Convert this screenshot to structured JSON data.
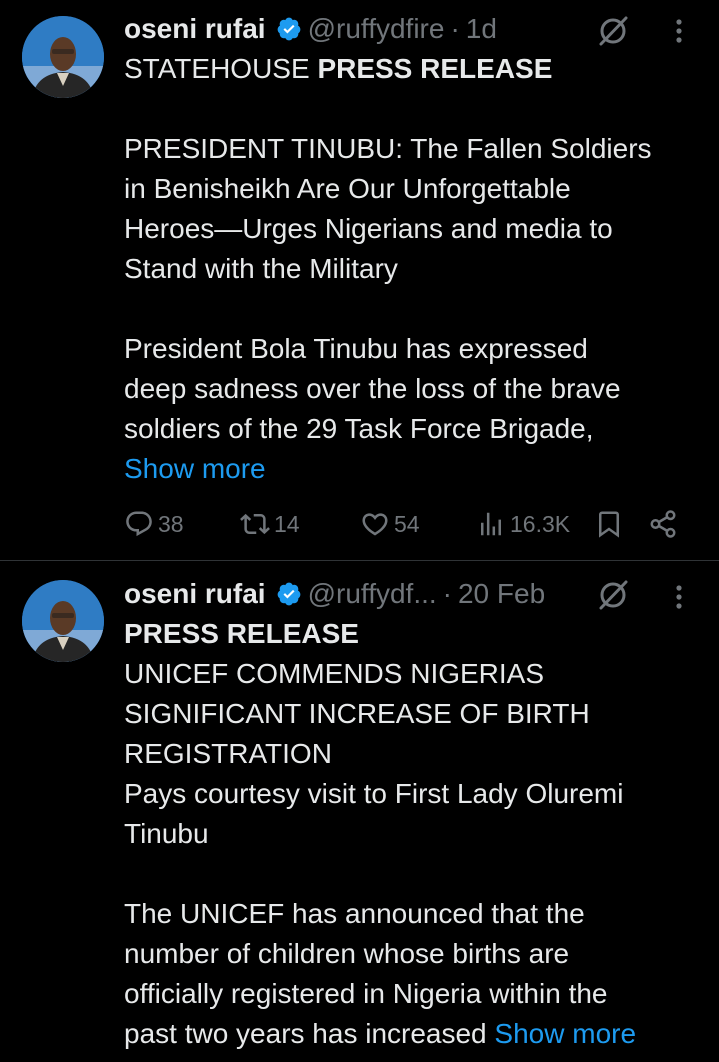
{
  "tweets": [
    {
      "author_name": "oseni rufai",
      "handle": "@ruffydfire",
      "time": "1d",
      "line1_plain": "STATEHOUSE ",
      "line1_bold": "PRESS RELEASE",
      "lines": [
        "PRESIDENT TINUBU: The Fallen Soldiers",
        "in Benisheikh Are Our Unforgettable",
        "Heroes—Urges Nigerians and media  to",
        "Stand with the Military",
        "President Bola Tinubu has expressed",
        "deep sadness over the loss of the brave",
        "soldiers of the 29 Task Force Brigade,"
      ],
      "show_more": "Show more",
      "replies": "38",
      "reposts": "14",
      "likes": "54",
      "views": "16.3K"
    },
    {
      "author_name": "oseni rufai",
      "handle": "@ruffydf...",
      "time": "20 Feb",
      "line1_bold": "PRESS RELEASE",
      "lines": [
        "UNICEF COMMENDS NIGERIAS",
        "SIGNIFICANT INCREASE OF BIRTH",
        "REGISTRATION",
        "Pays courtesy visit to First Lady Oluremi",
        "Tinubu",
        "The UNICEF has announced that the",
        "number of children whose births are",
        "officially registered in Nigeria within the",
        "past two years has increased "
      ],
      "show_more": "Show more"
    }
  ],
  "separator": "·",
  "colors": {
    "background": "#000000",
    "text": "#e7e9ea",
    "muted": "#71767b",
    "link": "#1d9bf0",
    "verified": "#1d9bf0",
    "divider": "#2f3336"
  },
  "icons": [
    "verified-badge-icon",
    "grok-icon",
    "more-options-icon",
    "reply-icon",
    "repost-icon",
    "like-icon",
    "views-icon",
    "bookmark-icon",
    "share-icon"
  ]
}
